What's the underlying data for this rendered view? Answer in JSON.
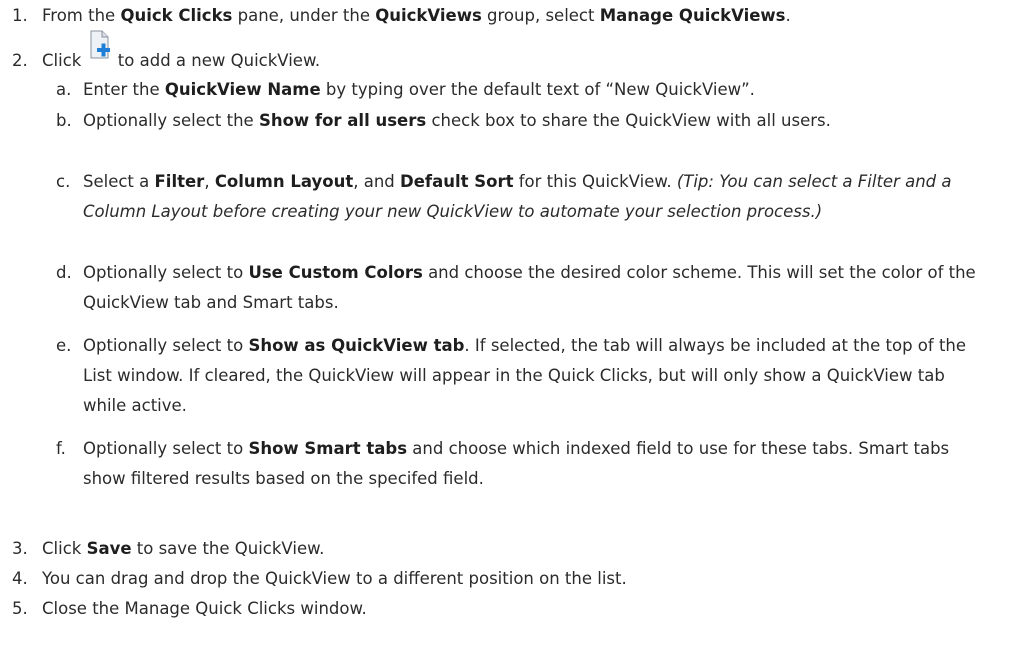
{
  "steps": [
    {
      "num": "1.",
      "pre": "From the ",
      "b1": "Quick Clicks",
      "mid1": " pane, under the ",
      "b2": "QuickViews",
      "mid2": " group, select ",
      "b3": "Manage QuickViews",
      "post": "."
    },
    {
      "num": "2.",
      "pre": "Click ",
      "icon": "new-document-add-icon",
      "post": " to add a new QuickView.",
      "subs": [
        {
          "letter": "a.",
          "pre": "Enter the ",
          "b1": "QuickView Name",
          "post": " by typing over the default text of “New QuickView”."
        },
        {
          "letter": "b.",
          "pre": "Optionally select the ",
          "b1": "Show for all users",
          "post": " check box to share the QuickView with all users."
        },
        {
          "letter": "c.",
          "pre": "Select a ",
          "b1": "Filter",
          "mid1": ", ",
          "b2": "Column Layout",
          "mid2": ", and ",
          "b3": "Default Sort",
          "mid3": " for this QuickView. ",
          "tip": "(Tip: You can select a Filter and a Column Layout before creating your new QuickView to automate your selection process.)"
        },
        {
          "letter": "d.",
          "pre": "Optionally select to ",
          "b1": "Use Custom Colors",
          "post": " and choose the desired color scheme. This will set the color of the QuickView tab and Smart tabs."
        },
        {
          "letter": "e.",
          "pre": "Optionally select to ",
          "b1": "Show as QuickView tab",
          "post": ". If selected, the tab will always be included at the top of the List window. If cleared, the QuickView will appear in the Quick Clicks, but will only show a QuickView tab while active."
        },
        {
          "letter": "f.",
          "pre": "Optionally select to ",
          "b1": "Show Smart tabs",
          "post": " and choose which indexed field to use for these tabs. Smart tabs show filtered results based on the specifed field."
        }
      ]
    },
    {
      "num": "3.",
      "pre": "Click ",
      "b1": "Save",
      "post": " to save the QuickView."
    },
    {
      "num": "4.",
      "pre": "You can drag and drop the QuickView to a different position on the list."
    },
    {
      "num": "5.",
      "pre": "Close the Manage Quick Clicks window."
    }
  ],
  "colors": {
    "text": "#2b2b2b",
    "icon_blue": "#1f7fd6",
    "icon_page": "#e8ecf2"
  }
}
